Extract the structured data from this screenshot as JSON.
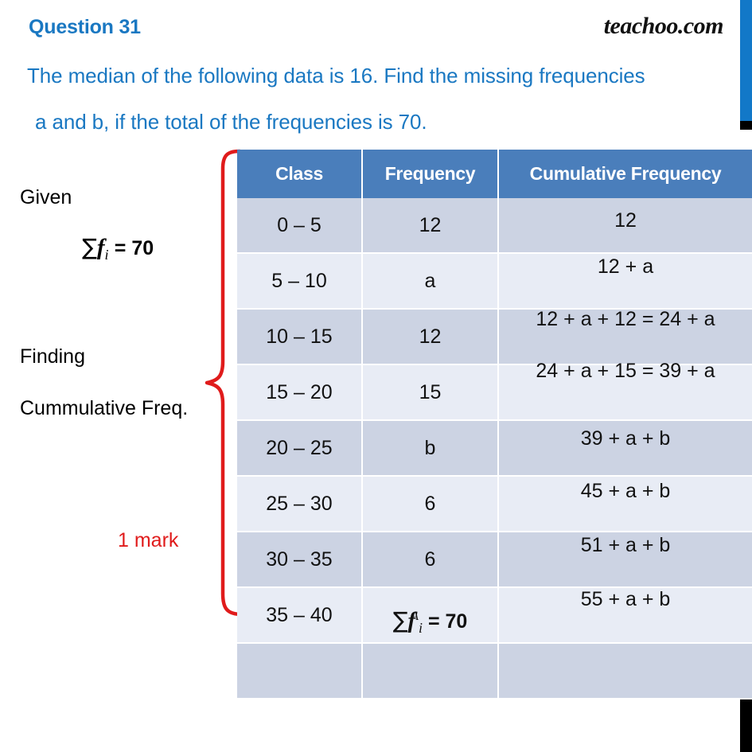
{
  "header": {
    "question_label": "Question 31",
    "brand": "teachoo.com",
    "question_line_1": "The median of the following data is 16. Find the missing frequencies",
    "question_line_2": "a and b, if the total of the frequencies is 70."
  },
  "annotations": {
    "given_label": "Given",
    "given_formula_sigma": "∑",
    "given_formula_f": "f",
    "given_formula_sub": "i",
    "given_formula_eq": "= 70",
    "finding_label": "Finding",
    "cumfreq_label": "Cummulative Freq.",
    "mark_label": "1 mark",
    "brace_color": "#e01b1b"
  },
  "colors": {
    "accent_blue": "#1a78c2",
    "header_blue": "#4a7ebb",
    "row_dark": "#ccd3e3",
    "row_light": "#e8ecf5",
    "bar_blue": "#1278c8",
    "red": "#e01b1b"
  },
  "table": {
    "headers": [
      "Class",
      "Frequency",
      "Cumulative Frequency"
    ],
    "rows": [
      {
        "class": "0 – 5",
        "frequency": "12",
        "cumulative": "12"
      },
      {
        "class": "5 – 10",
        "frequency": "a",
        "cumulative": "12 + a"
      },
      {
        "class": "10 – 15",
        "frequency": "12",
        "cumulative": "12 + a + 12  = 24 + a"
      },
      {
        "class": "15 – 20",
        "frequency": "15",
        "cumulative": "24 + a + 15  = 39 + a"
      },
      {
        "class": "20 – 25",
        "frequency": "b",
        "cumulative": "39 + a + b"
      },
      {
        "class": "25 – 30",
        "frequency": "6",
        "cumulative": "45 + a + b"
      },
      {
        "class": "30 – 35",
        "frequency": "6",
        "cumulative": "51 + a + b"
      },
      {
        "class": "35 – 40",
        "frequency": "",
        "cumulative": "55 + a + b"
      },
      {
        "class": "",
        "frequency": "",
        "cumulative": ""
      }
    ],
    "frequency_total": {
      "sigma": "∑",
      "f": "f",
      "sup": "A",
      "sub": "i",
      "eq": "= 70"
    }
  }
}
